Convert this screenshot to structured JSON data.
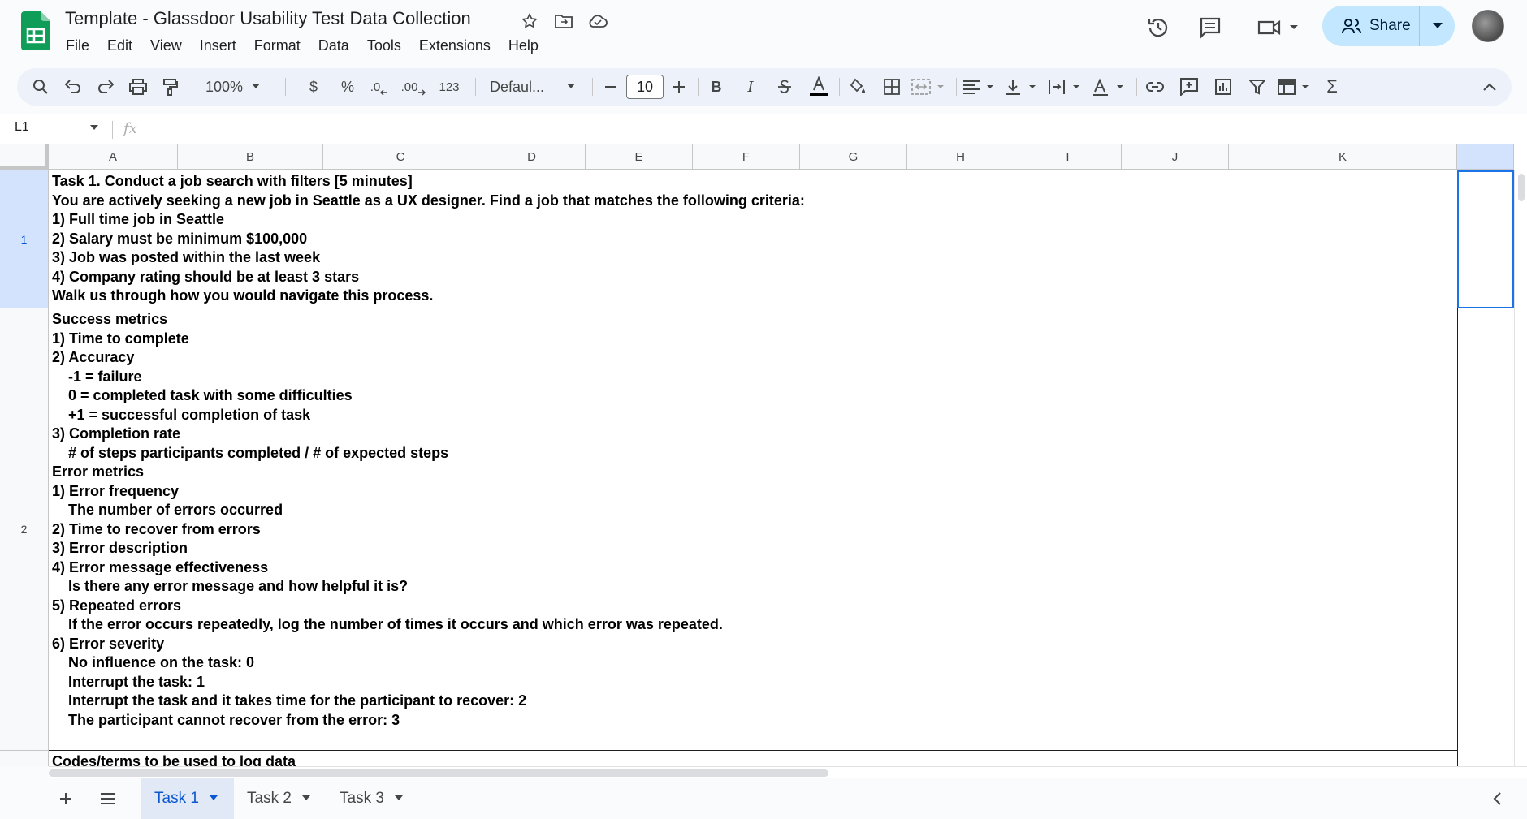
{
  "doc": {
    "title": "Template - Glassdoor Usability Test Data Collection"
  },
  "menu": [
    "File",
    "Edit",
    "View",
    "Insert",
    "Format",
    "Data",
    "Tools",
    "Extensions",
    "Help"
  ],
  "share": {
    "label": "Share"
  },
  "toolbar": {
    "zoom": "100%",
    "currency": "$",
    "percent": "%",
    "dec_decrease": ".0",
    "dec_increase": ".00",
    "number_format": "123",
    "font": "Defaul...",
    "font_size": "10",
    "bold": "B",
    "italic": "I",
    "sum": "Σ"
  },
  "formula": {
    "cell_ref": "L1",
    "fx": "fx"
  },
  "columns": [
    "A",
    "B",
    "C",
    "D",
    "E",
    "F",
    "G",
    "H",
    "I",
    "J",
    "K"
  ],
  "rows": {
    "r1": {
      "num": "1",
      "text": "Task 1. Conduct a job search with filters [5 minutes]\nYou are actively seeking a new job in Seattle as a UX designer. Find a job that matches the following criteria:\n1) Full time job in Seattle\n2) Salary must be minimum $100,000\n3) Job was posted within the last week\n4) Company rating should be at least 3 stars\nWalk us through how you would navigate this process."
    },
    "r2": {
      "num": "2",
      "text": "Success metrics\n1) Time to complete\n2) Accuracy\n    -1 = failure\n    0 = completed task with some difficulties\n    +1 = successful completion of task\n3) Completion rate\n    # of steps participants completed / # of expected steps\nError metrics\n1) Error frequency\n    The number of errors occurred\n2) Time to recover from errors\n3) Error description\n4) Error message effectiveness\n    Is there any error message and how helpful it is?\n5) Repeated errors\n    If the error occurs repeatedly, log the number of times it occurs and which error was repeated.\n6) Error severity\n    No influence on the task: 0\n    Interrupt the task: 1\n    Interrupt the task and it takes time for the participant to recover: 2\n    The participant cannot recover from the error: 3"
    },
    "r3": {
      "text": "Codes/terms to be used to log data"
    }
  },
  "tabs": [
    "Task 1",
    "Task 2",
    "Task 3"
  ],
  "colors": {
    "accent": "#0b57d0",
    "share_bg": "#c2e7ff",
    "selection": "#1a73e8",
    "sheets_green": "#0f9d58"
  }
}
